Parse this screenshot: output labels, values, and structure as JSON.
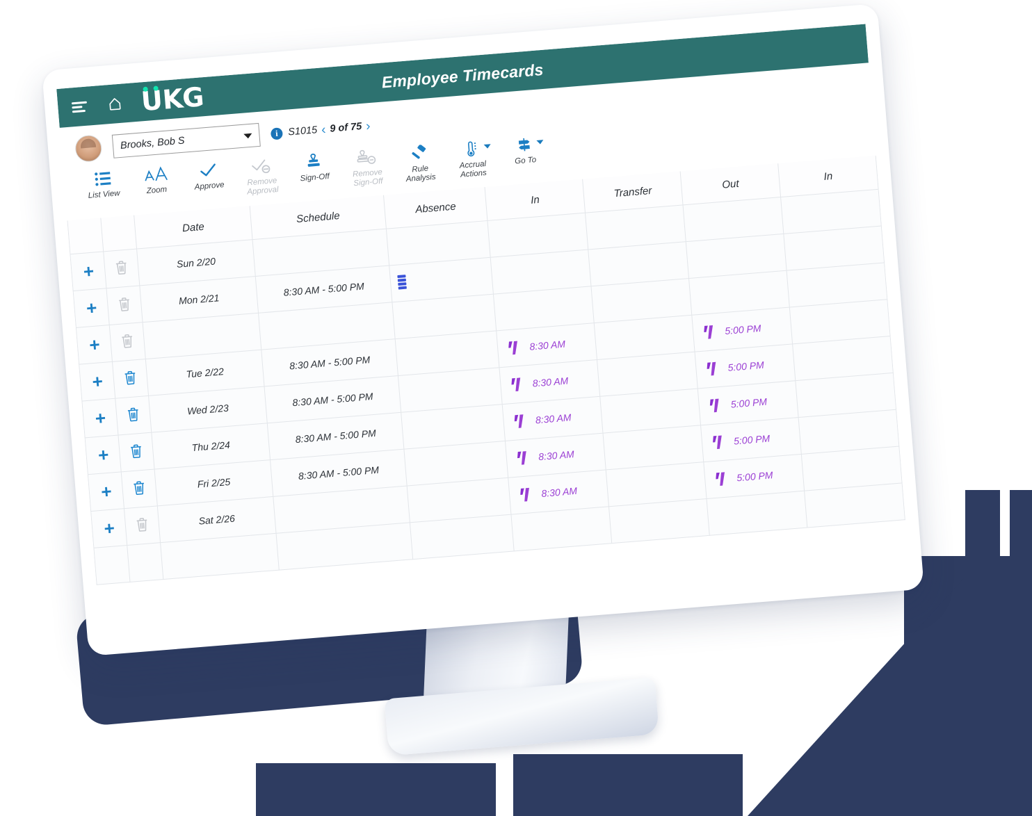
{
  "app": {
    "header": {
      "title": "Employee Timecards",
      "menu_icon": "hamburger-icon",
      "home_icon": "home-icon",
      "brand": {
        "u": "U",
        "kg": "KG",
        "full": "UKG"
      },
      "bar_color": "#2d7270",
      "accent_green": "#12e5b0"
    },
    "employee_bar": {
      "avatar": "employee-avatar",
      "selected_employee": "Brooks, Bob S",
      "info_badge": "i",
      "employee_id": "S1015",
      "prev_label": "‹",
      "next_label": "›",
      "record_counter": "9 of 75"
    },
    "toolbar": [
      {
        "label": "List View",
        "icon": "list-view-icon",
        "disabled": false,
        "has_caret": false
      },
      {
        "label": "Zoom",
        "icon": "zoom-icon",
        "disabled": false,
        "has_caret": false
      },
      {
        "label": "Approve",
        "icon": "approve-check-icon",
        "disabled": false,
        "has_caret": false
      },
      {
        "label": "Remove\nApproval",
        "icon": "remove-approval-icon",
        "disabled": true,
        "has_caret": false
      },
      {
        "label": "Sign-Off",
        "icon": "stamp-icon",
        "disabled": false,
        "has_caret": false
      },
      {
        "label": "Remove\nSign-Off",
        "icon": "remove-signoff-icon",
        "disabled": true,
        "has_caret": false
      },
      {
        "label": "Rule\nAnalysis",
        "icon": "gavel-icon",
        "disabled": false,
        "has_caret": false
      },
      {
        "label": "Accrual\nActions",
        "icon": "thermometer-icon",
        "disabled": false,
        "has_caret": true
      },
      {
        "label": "Go To",
        "icon": "signpost-icon",
        "disabled": false,
        "has_caret": true
      }
    ],
    "table": {
      "columns": [
        "",
        "",
        "Date",
        "Schedule",
        "Absence",
        "In",
        "Transfer",
        "Out",
        "In"
      ],
      "rows": [
        {
          "add": "+",
          "delete": "trash-icon",
          "delete_enabled": false,
          "date": "Sun 2/20",
          "schedule": "",
          "absence": "",
          "in": "",
          "transfer": "",
          "out": "",
          "in2": ""
        },
        {
          "add": "+",
          "delete": "trash-icon",
          "delete_enabled": false,
          "date": "Mon 2/21",
          "schedule": "8:30 AM - 5:00 PM",
          "absence": "absence-bars-icon",
          "in": "",
          "transfer": "",
          "out": "",
          "in2": ""
        },
        {
          "add": "+",
          "delete": "trash-icon",
          "delete_enabled": false,
          "date": "",
          "schedule": "",
          "absence": "",
          "in": "",
          "transfer": "",
          "out": "",
          "in2": ""
        },
        {
          "add": "+",
          "delete": "trash-icon",
          "delete_enabled": true,
          "date": "Tue 2/22",
          "schedule": "8:30 AM - 5:00 PM",
          "absence": "",
          "in": "8:30 AM",
          "transfer": "",
          "out": "5:00 PM",
          "in2": ""
        },
        {
          "add": "+",
          "delete": "trash-icon",
          "delete_enabled": true,
          "date": "Wed 2/23",
          "schedule": "8:30 AM - 5:00 PM",
          "absence": "",
          "in": "8:30 AM",
          "transfer": "",
          "out": "5:00 PM",
          "in2": ""
        },
        {
          "add": "+",
          "delete": "trash-icon",
          "delete_enabled": true,
          "date": "Thu 2/24",
          "schedule": "8:30 AM - 5:00 PM",
          "absence": "",
          "in": "8:30 AM",
          "transfer": "",
          "out": "5:00 PM",
          "in2": ""
        },
        {
          "add": "+",
          "delete": "trash-icon",
          "delete_enabled": true,
          "date": "Fri 2/25",
          "schedule": "8:30 AM - 5:00 PM",
          "absence": "",
          "in": "8:30 AM",
          "transfer": "",
          "out": "5:00 PM",
          "in2": ""
        },
        {
          "add": "+",
          "delete": "trash-icon",
          "delete_enabled": false,
          "date": "Sat 2/26",
          "schedule": "",
          "absence": "",
          "in": "8:30 AM",
          "transfer": "",
          "out": "5:00 PM",
          "in2": ""
        },
        {
          "add": "",
          "delete": "",
          "delete_enabled": false,
          "date": "",
          "schedule": "",
          "absence": "",
          "in": "",
          "transfer": "",
          "out": "",
          "in2": ""
        }
      ]
    },
    "colors": {
      "teal_header": "#2d7270",
      "link_blue": "#1c7fc4",
      "punch_purple": "#9b3fd4",
      "absence_blue": "#3a52d8",
      "navy_bg": "#2e3c61"
    }
  }
}
